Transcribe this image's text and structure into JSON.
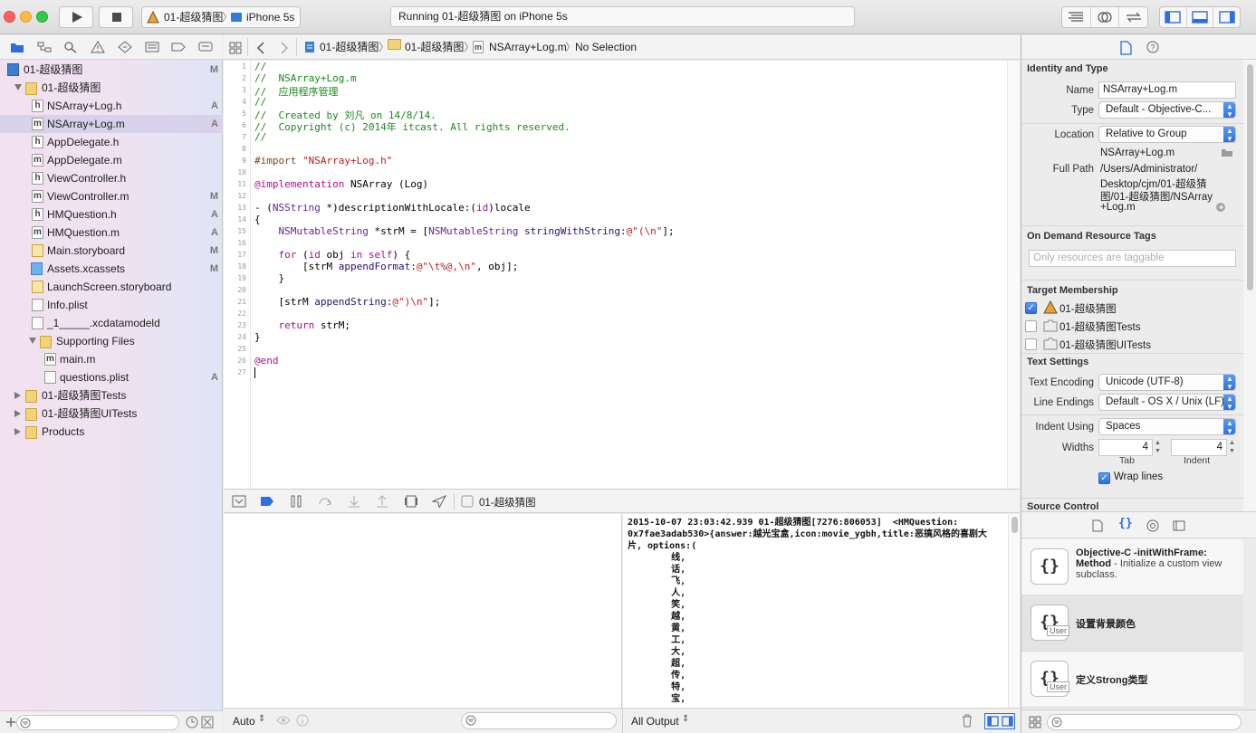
{
  "toolbar": {
    "scheme_name": "01-超级猜图",
    "device_name": "iPhone 5s",
    "activity_status": "Running 01-超级猜图 on iPhone 5s"
  },
  "navigator": {
    "tree": [
      {
        "label": "01-超级猜图",
        "badge": "M",
        "icon": "project-icon"
      },
      {
        "label": "01-超级猜图",
        "badge": "",
        "icon": "folder-icon"
      },
      {
        "label": "NSArray+Log.h",
        "badge": "A",
        "icon": "header-file-icon",
        "letter": "h"
      },
      {
        "label": "NSArray+Log.m",
        "badge": "A",
        "icon": "implementation-file-icon",
        "letter": "m"
      },
      {
        "label": "AppDelegate.h",
        "badge": "",
        "icon": "header-file-icon",
        "letter": "h"
      },
      {
        "label": "AppDelegate.m",
        "badge": "",
        "icon": "implementation-file-icon",
        "letter": "m"
      },
      {
        "label": "ViewController.h",
        "badge": "",
        "icon": "header-file-icon",
        "letter": "h"
      },
      {
        "label": "ViewController.m",
        "badge": "M",
        "icon": "implementation-file-icon",
        "letter": "m"
      },
      {
        "label": "HMQuestion.h",
        "badge": "A",
        "icon": "header-file-icon",
        "letter": "h"
      },
      {
        "label": "HMQuestion.m",
        "badge": "A",
        "icon": "implementation-file-icon",
        "letter": "m"
      },
      {
        "label": "Main.storyboard",
        "badge": "M",
        "icon": "storyboard-icon"
      },
      {
        "label": "Assets.xcassets",
        "badge": "M",
        "icon": "asset-catalog-icon"
      },
      {
        "label": "LaunchScreen.storyboard",
        "badge": "",
        "icon": "storyboard-icon"
      },
      {
        "label": "Info.plist",
        "badge": "",
        "icon": "plist-icon"
      },
      {
        "label": "_1_____.xcdatamodeld",
        "badge": "",
        "icon": "datamodel-icon"
      },
      {
        "label": "Supporting Files",
        "badge": "",
        "icon": "folder-icon"
      },
      {
        "label": "main.m",
        "badge": "",
        "icon": "implementation-file-icon",
        "letter": "m"
      },
      {
        "label": "questions.plist",
        "badge": "A",
        "icon": "plist-icon"
      },
      {
        "label": "01-超级猜图Tests",
        "badge": "",
        "icon": "folder-icon"
      },
      {
        "label": "01-超级猜图UITests",
        "badge": "",
        "icon": "folder-icon"
      },
      {
        "label": "Products",
        "badge": "",
        "icon": "folder-icon"
      }
    ]
  },
  "jumpbar": {
    "project": "01-超级猜图",
    "group": "01-超级猜图",
    "file": "NSArray+Log.m",
    "selection": "No Selection"
  },
  "editor": {
    "line_numbers": [
      "1",
      "2",
      "3",
      "4",
      "5",
      "6",
      "7",
      "8",
      "9",
      "10",
      "11",
      "12",
      "13",
      "14",
      "15",
      "16",
      "17",
      "18",
      "19",
      "20",
      "21",
      "22",
      "23",
      "24",
      "25",
      "26",
      "27"
    ],
    "lines": {
      "l1": "//",
      "l2": "//  NSArray+Log.m",
      "l3": "//  应用程序管理",
      "l4": "//",
      "l5": "//  Created by 刘凡 on 14/8/14.",
      "l6": "//  Copyright (c) 2014年 itcast. All rights reserved.",
      "l7": "//",
      "l9a": "#import ",
      "l9b": "\"NSArray+Log.h\"",
      "l11a": "@implementation",
      "l11b": " NSArray (Log)",
      "l13a": "- (",
      "l13b": "NSString",
      "l13c": " *)descriptionWithLocale:(",
      "l13d": "id",
      "l13e": ")locale",
      "l14": "{",
      "l15a": "    ",
      "l15b": "NSMutableString",
      "l15c": " *strM = [",
      "l15d": "NSMutableString",
      "l15e": " stringWithString:",
      "l15f": "@\"(\\n\"",
      "l15g": "];",
      "l17a": "    ",
      "l17b": "for",
      "l17c": " (",
      "l17d": "id",
      "l17e": " obj ",
      "l17f": "in",
      "l17g": " ",
      "l17h": "self",
      "l17i": ") {",
      "l18a": "        [strM ",
      "l18b": "appendFormat:",
      "l18c": "@\"\\t%@,\\n\"",
      "l18d": ", obj];",
      "l19": "    }",
      "l21a": "    [strM ",
      "l21b": "appendString:",
      "l21c": "@\")\\n\"",
      "l21d": "];",
      "l23a": "    ",
      "l23b": "return",
      "l23c": " strM;",
      "l24": "}",
      "l26": "@end"
    }
  },
  "debugbar": {
    "process": "01-超级猜图"
  },
  "console": {
    "output": "2015-10-07 23:03:42.939 01-超级猜图[7276:806053]  <HMQuestion: 0x7fae3adab530>{answer:越光宝盒,icon:movie_ygbh,title:恶搞风格的喜剧大片, options:(\n\t线,\n\t话,\n\t飞,\n\t人,\n\t笑,\n\t越,\n\t黄,\n\t工,\n\t大,\n\t超,\n\t传,\n\t特,\n\t宝,"
  },
  "bottombar": {
    "auto_label": "Auto",
    "output_label": "All Output"
  },
  "inspector": {
    "identity_header": "Identity and Type",
    "name_label": "Name",
    "name_value": "NSArray+Log.m",
    "type_label": "Type",
    "type_value": "Default - Objective-C...",
    "location_label": "Location",
    "location_value": "Relative to Group",
    "location_file": "NSArray+Log.m",
    "full_path_label": "Full Path",
    "full_path_l1": "/Users/Administrator/",
    "full_path_l2": "Desktop/cjm/01-超级猜",
    "full_path_l3": "图/01-超级猜图/NSArray",
    "full_path_l4": "+Log.m",
    "odr_header": "On Demand Resource Tags",
    "odr_placeholder": "Only resources are taggable",
    "target_header": "Target Membership",
    "targets": [
      {
        "label": "01-超级猜图",
        "checked": true
      },
      {
        "label": "01-超级猜图Tests",
        "checked": false
      },
      {
        "label": "01-超级猜图UITests",
        "checked": false
      }
    ],
    "text_settings_header": "Text Settings",
    "encoding_label": "Text Encoding",
    "encoding_value": "Unicode (UTF-8)",
    "line_endings_label": "Line Endings",
    "line_endings_value": "Default - OS X / Unix (LF)",
    "indent_label": "Indent Using",
    "indent_value": "Spaces",
    "widths_label": "Widths",
    "tab_width": "4",
    "indent_width": "4",
    "tab_caption": "Tab",
    "indent_caption": "Indent",
    "wrap_label": "Wrap lines",
    "source_control_header": "Source Control"
  },
  "library": {
    "items": [
      {
        "title": "Objective-C -initWithFrame: Method",
        "desc": " - Initialize a custom view subclass.",
        "user": ""
      },
      {
        "title": "设置背景颜色",
        "desc": "",
        "user": "User"
      },
      {
        "title": "定义Strong类型",
        "desc": "",
        "user": "User"
      }
    ]
  },
  "colors": {
    "accent": "#2b6fe0",
    "comment": "#1a8a1a",
    "string": "#c41a16",
    "keyword": "#aa0d91",
    "selection": "#d7d2ea"
  }
}
